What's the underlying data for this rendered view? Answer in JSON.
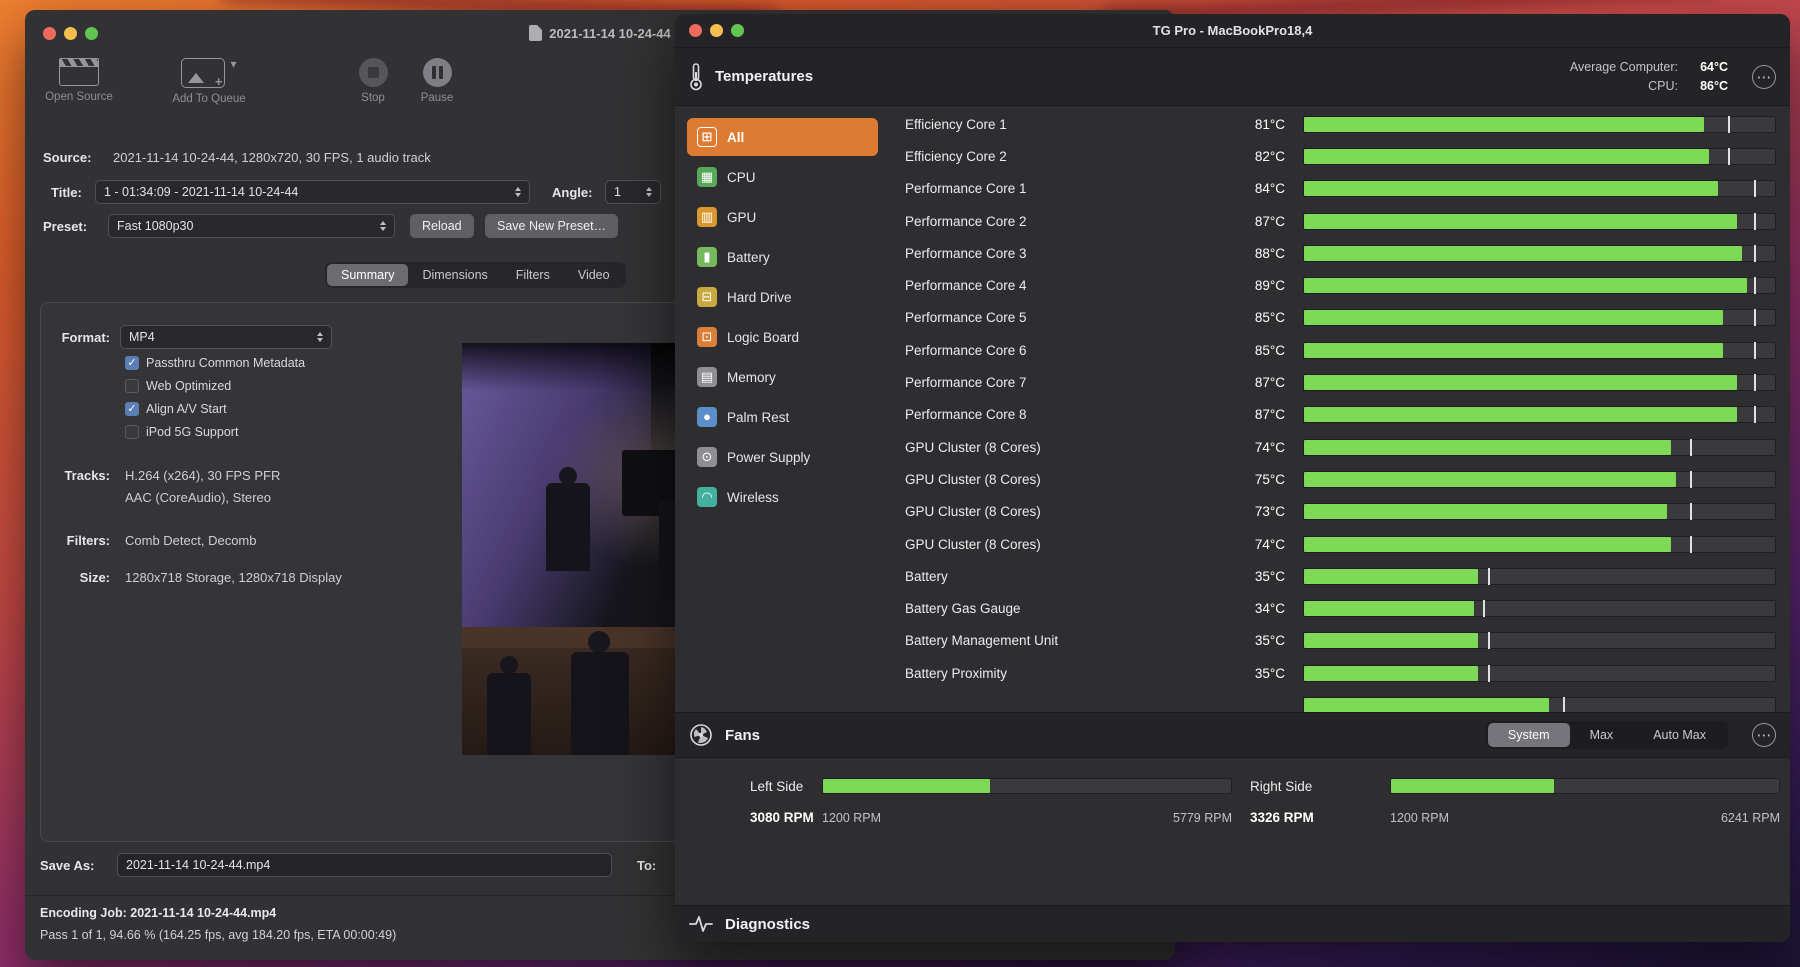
{
  "handbrake": {
    "window_title": "2021-11-14 10-24-44",
    "toolbar": {
      "open_source": "Open Source",
      "add_to_queue": "Add To Queue",
      "stop": "Stop",
      "pause": "Pause"
    },
    "source_row": {
      "label": "Source:",
      "value": "2021-11-14 10-24-44, 1280x720, 30 FPS, 1 audio track"
    },
    "title_row": {
      "label": "Title:",
      "value": "1 - 01:34:09 - 2021-11-14 10-24-44",
      "angle_label": "Angle:",
      "angle_value": "1"
    },
    "preset_row": {
      "label": "Preset:",
      "value": "Fast 1080p30",
      "reload_button": "Reload",
      "save_preset_button": "Save New Preset…"
    },
    "tabs": {
      "summary": "Summary",
      "dimensions": "Dimensions",
      "filters": "Filters",
      "video": "Video",
      "active": "Summary"
    },
    "summary_tab": {
      "format_label": "Format:",
      "format_value": "MP4",
      "checkboxes": {
        "passthru": {
          "label": "Passthru Common Metadata",
          "checked": true
        },
        "web_optimized": {
          "label": "Web Optimized",
          "checked": false
        },
        "align_av": {
          "label": "Align A/V Start",
          "checked": true
        },
        "ipod": {
          "label": "iPod 5G Support",
          "checked": false
        }
      },
      "tracks_label": "Tracks:",
      "tracks_line1": "H.264 (x264), 30 FPS PFR",
      "tracks_line2": "AAC (CoreAudio), Stereo",
      "filters_label": "Filters:",
      "filters_value": "Comb Detect, Decomb",
      "size_label": "Size:",
      "size_value": "1280x718 Storage, 1280x718 Display"
    },
    "save_row": {
      "label": "Save As:",
      "value": "2021-11-14 10-24-44.mp4",
      "to_label": "To:"
    },
    "status": {
      "line1": "Encoding Job: 2021-11-14 10-24-44.mp4",
      "line2": "Pass 1 of 1, 94.66 % (164.25 fps, avg 184.20 fps, ETA 00:00:49)"
    }
  },
  "tgpro": {
    "window_title": "TG Pro - MacBookPro18,4",
    "accent_orange": "#dd7b33",
    "bar_green": "#7ed957",
    "temperatures": {
      "title": "Temperatures",
      "average_label": "Average Computer:",
      "average_value": "64°C",
      "cpu_label": "CPU:",
      "cpu_value": "86°C",
      "sidebar": [
        {
          "label": "All",
          "icon": "grid-icon",
          "selected": true
        },
        {
          "label": "CPU",
          "icon": "cpu-icon",
          "color": "#58a85a"
        },
        {
          "label": "GPU",
          "icon": "gpu-icon",
          "color": "#d9982f"
        },
        {
          "label": "Battery",
          "icon": "battery-icon",
          "color": "#76b85e"
        },
        {
          "label": "Hard Drive",
          "icon": "hard-drive-icon",
          "color": "#c9a83f"
        },
        {
          "label": "Logic Board",
          "icon": "logic-board-icon",
          "color": "#d97f3a"
        },
        {
          "label": "Memory",
          "icon": "memory-icon",
          "color": "#8e8e93"
        },
        {
          "label": "Palm Rest",
          "icon": "palm-rest-icon",
          "color": "#5a8fc9"
        },
        {
          "label": "Power Supply",
          "icon": "power-icon",
          "color": "#8e8e93"
        },
        {
          "label": "Wireless",
          "icon": "wifi-icon",
          "color": "#45b0a0"
        }
      ],
      "rows": [
        {
          "label": "Efficiency Core 1",
          "value": "81°C",
          "percent": 85,
          "tick": 90
        },
        {
          "label": "Efficiency Core 2",
          "value": "82°C",
          "percent": 86,
          "tick": 90
        },
        {
          "label": "Performance Core 1",
          "value": "84°C",
          "percent": 88,
          "tick": 95.5
        },
        {
          "label": "Performance Core 2",
          "value": "87°C",
          "percent": 92,
          "tick": 95.5
        },
        {
          "label": "Performance Core 3",
          "value": "88°C",
          "percent": 93,
          "tick": 95.5
        },
        {
          "label": "Performance Core 4",
          "value": "89°C",
          "percent": 94,
          "tick": 95.5
        },
        {
          "label": "Performance Core 5",
          "value": "85°C",
          "percent": 89,
          "tick": 95.5
        },
        {
          "label": "Performance Core 6",
          "value": "85°C",
          "percent": 89,
          "tick": 95.5
        },
        {
          "label": "Performance Core 7",
          "value": "87°C",
          "percent": 92,
          "tick": 95.5
        },
        {
          "label": "Performance Core 8",
          "value": "87°C",
          "percent": 92,
          "tick": 95.5
        },
        {
          "label": "GPU Cluster (8 Cores)",
          "value": "74°C",
          "percent": 78,
          "tick": 82
        },
        {
          "label": "GPU Cluster (8 Cores)",
          "value": "75°C",
          "percent": 79,
          "tick": 82
        },
        {
          "label": "GPU Cluster (8 Cores)",
          "value": "73°C",
          "percent": 77,
          "tick": 82
        },
        {
          "label": "GPU Cluster (8 Cores)",
          "value": "74°C",
          "percent": 78,
          "tick": 82
        },
        {
          "label": "Battery",
          "value": "35°C",
          "percent": 37,
          "tick": 39
        },
        {
          "label": "Battery Gas Gauge",
          "value": "34°C",
          "percent": 36,
          "tick": 38
        },
        {
          "label": "Battery Management Unit",
          "value": "35°C",
          "percent": 37,
          "tick": 39
        },
        {
          "label": "Battery Proximity",
          "value": "35°C",
          "percent": 37,
          "tick": 39
        },
        {
          "label": "",
          "value": "",
          "percent": 52,
          "tick": 55
        }
      ]
    },
    "fans": {
      "title": "Fans",
      "modes": {
        "system": "System",
        "max": "Max",
        "auto_max": "Auto Max"
      },
      "active_mode": "System",
      "left": {
        "name": "Left Side",
        "current": "3080 RPM",
        "min": "1200 RPM",
        "max": "5779 RPM",
        "percent": 41
      },
      "right": {
        "name": "Right Side",
        "current": "3326 RPM",
        "min": "1200 RPM",
        "max": "6241 RPM",
        "percent": 42
      }
    },
    "diagnostics": {
      "title": "Diagnostics"
    }
  }
}
